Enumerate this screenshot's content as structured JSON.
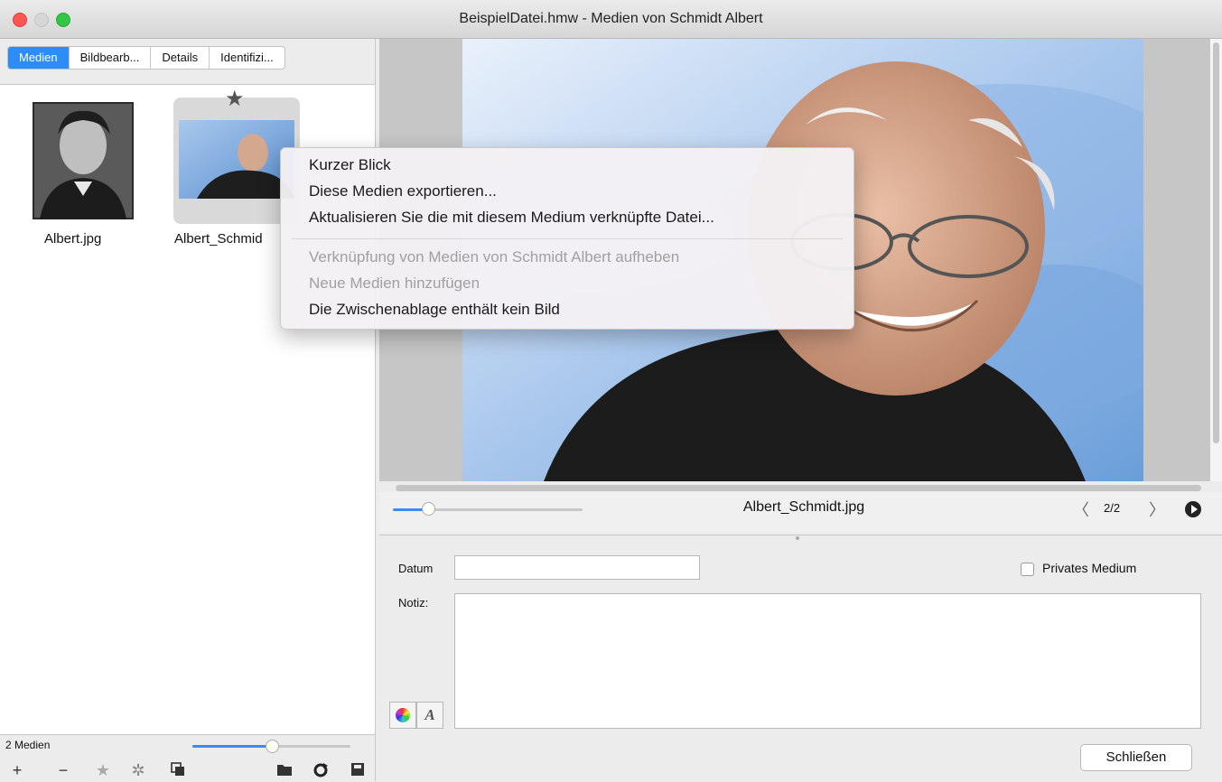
{
  "window": {
    "title": "BeispielDatei.hmw - Medien von Schmidt Albert"
  },
  "sidebar": {
    "tabs": [
      {
        "label": "Medien",
        "active": true
      },
      {
        "label": "Bildbearb..."
      },
      {
        "label": "Details"
      },
      {
        "label": "Identifizi..."
      }
    ],
    "items": [
      {
        "label": "Albert.jpg"
      },
      {
        "label": "Albert_Schmid",
        "favorite_icon": "star-icon"
      }
    ],
    "status": {
      "count": "2 Medien",
      "zoom_fraction": 0.5
    },
    "toolbar_icons": [
      "plus-icon",
      "minus-icon",
      "star-icon",
      "gear-icon",
      "copy-icon",
      "folder-icon",
      "refresh-icon",
      "save-icon"
    ]
  },
  "viewer": {
    "filename": "Albert_Schmidt.jpg",
    "page_counter": "2/2",
    "zoom_fraction": 0.15
  },
  "form": {
    "date_label": "Datum",
    "date_value": "",
    "private_label": "Privates Medium",
    "private_checked": false,
    "note_label": "Notiz:",
    "note_value": "",
    "close_label": "Schließen"
  },
  "context_menu": {
    "items": [
      {
        "label": "Kurzer Blick",
        "enabled": true
      },
      {
        "label": "Diese Medien exportieren...",
        "enabled": true
      },
      {
        "label": "Aktualisieren Sie die mit diesem Medium verknüpfte Datei...",
        "enabled": true
      },
      {
        "label": "Verknüpfung von Medien von Schmidt Albert aufheben",
        "enabled": false
      },
      {
        "label": "Neue Medien hinzufügen",
        "enabled": false
      },
      {
        "label": "Die Zwischenablage enthält kein Bild",
        "enabled": true
      }
    ]
  },
  "colors": {
    "accent": "#2d8cf5",
    "close": "#fc5753",
    "maximize": "#33c748"
  }
}
